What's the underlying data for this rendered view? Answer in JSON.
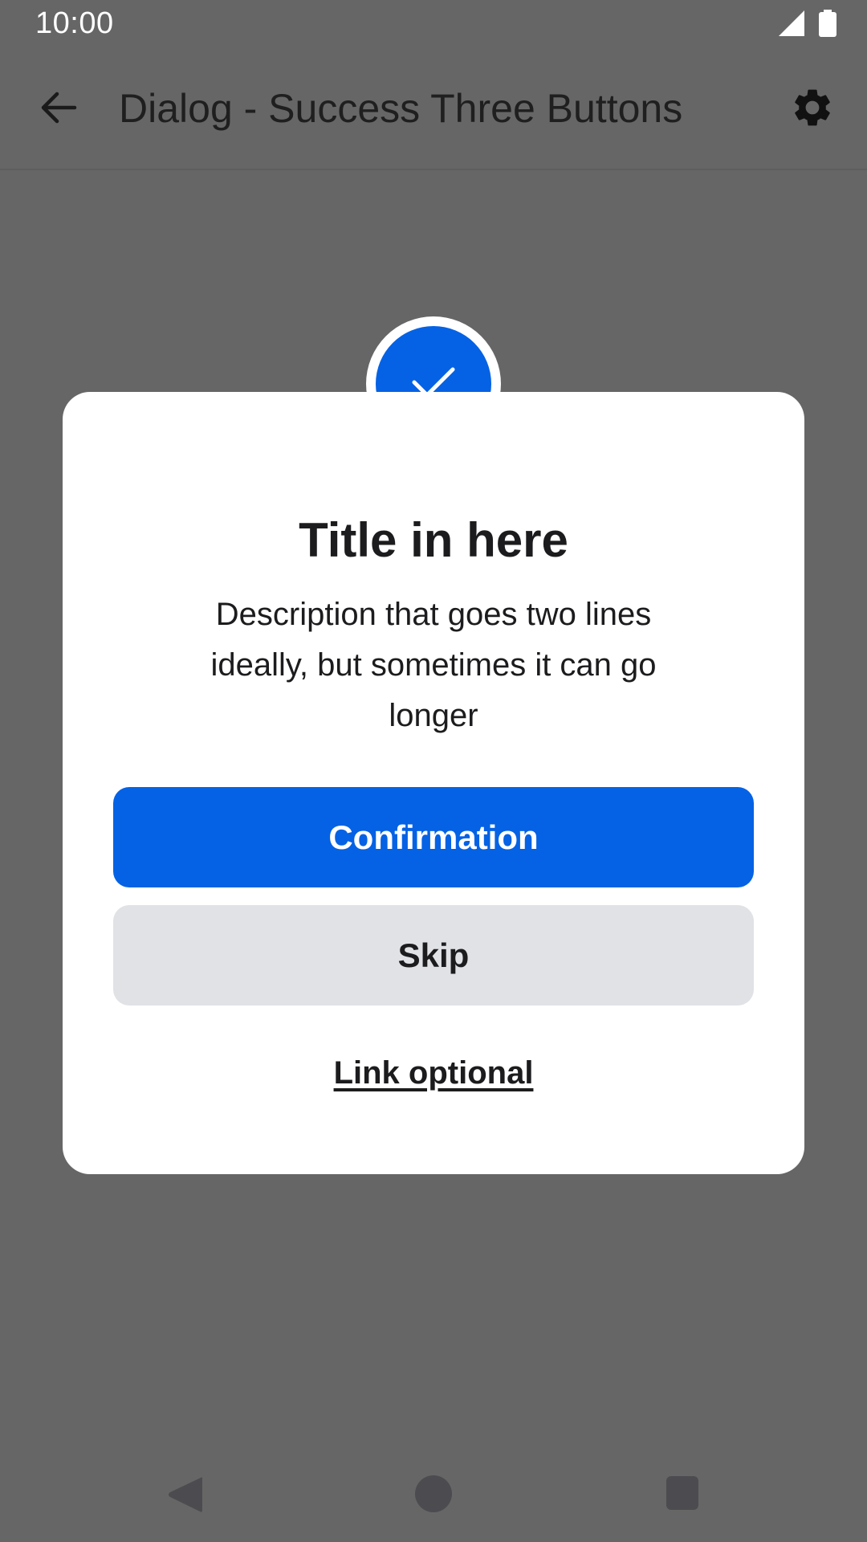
{
  "status_bar": {
    "time": "10:00",
    "icons": [
      "cell-signal-icon",
      "battery-icon"
    ]
  },
  "app_bar": {
    "title": "Dialog - Success Three Buttons",
    "back_icon": "arrow-back-icon",
    "settings_icon": "gear-icon"
  },
  "dialog": {
    "icon": "checkmark-icon",
    "title": "Title in here",
    "description": "Description that goes two lines ideally, but sometimes it can go longer",
    "primary_button": "Confirmation",
    "secondary_button": "Skip",
    "link": "Link optional"
  },
  "nav_bar": {
    "icons": [
      "nav-back-icon",
      "nav-home-icon",
      "nav-recents-icon"
    ]
  },
  "colors": {
    "accent": "#0562e4",
    "scrim": "#666666",
    "secondary_button_bg": "#e0e2e6",
    "text": "#1c1c1e"
  }
}
